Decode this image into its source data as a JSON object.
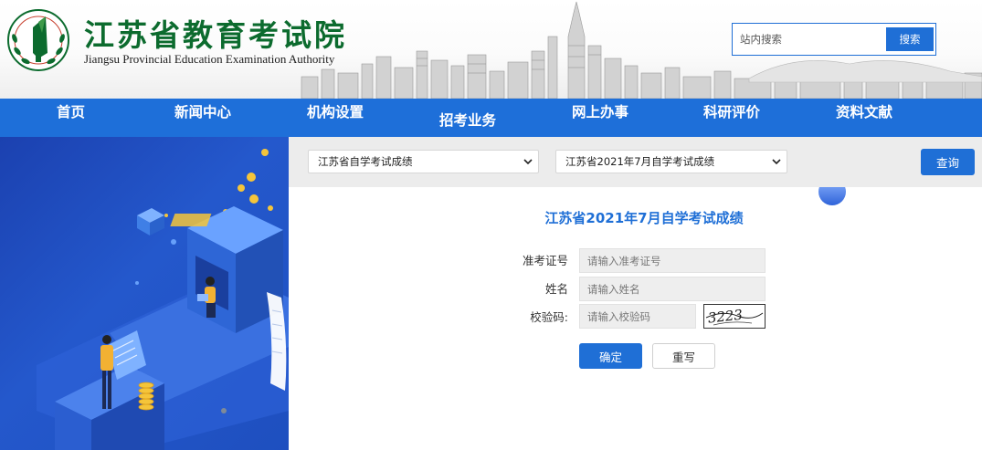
{
  "header": {
    "title": "江苏省教育考试院",
    "subtitle": "Jiangsu Provincial Education Examination Authority",
    "logo_icon": "green-torch-seal-logo"
  },
  "search": {
    "placeholder": "站内搜索",
    "button_label": "搜索"
  },
  "nav": {
    "items": [
      {
        "label": "首页"
      },
      {
        "label": "新闻中心"
      },
      {
        "label": "机构设置"
      },
      {
        "label": "招考业务"
      },
      {
        "label": "网上办事"
      },
      {
        "label": "科研评价"
      },
      {
        "label": "资料文献"
      }
    ]
  },
  "query": {
    "category_selected": "江苏省自学考试成绩",
    "exam_selected": "江苏省2021年7月自学考试成绩",
    "button_label": "查询"
  },
  "form": {
    "title": "江苏省2021年7月自学考试成绩",
    "fields": [
      {
        "label": "准考证号",
        "placeholder": "请输入准考证号"
      },
      {
        "label": "姓名",
        "placeholder": "请输入姓名"
      },
      {
        "label": "校验码:",
        "placeholder": "请输入校验码"
      }
    ],
    "captcha_text": "3223",
    "submit_label": "确定",
    "reset_label": "重写"
  },
  "colors": {
    "accent": "#1f6fd6",
    "nav_bg": "#1e6fd9",
    "brand_green": "#0c6b2e",
    "illustration_bg": "#1e4fbf"
  }
}
